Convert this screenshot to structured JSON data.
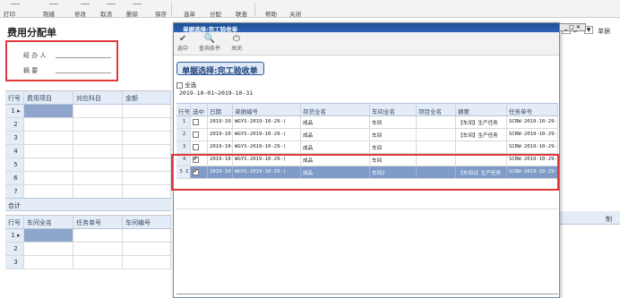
{
  "toolbar": {
    "items": [
      "打印",
      "制缝",
      "修改",
      "取消",
      "删除",
      "保存",
      "选单",
      "分配",
      "联查",
      "帮助",
      "关闭"
    ],
    "right": "单据"
  },
  "form": {
    "title": "费用分配单",
    "agent_label": "经 办 人",
    "summary_label": "摘    要"
  },
  "grid1": {
    "headers": [
      "行号",
      "费用项目",
      "对应科目",
      "金额"
    ],
    "rows": [
      "1",
      "2",
      "3",
      "4",
      "5",
      "6",
      "7"
    ],
    "total_label": "合计"
  },
  "grid2": {
    "headers": [
      "行号",
      "车间全名",
      "任务单号",
      "车间编号"
    ],
    "rows": [
      "1",
      "2",
      "3"
    ],
    "right_header": "制"
  },
  "dialog": {
    "title": "单据选择:完工验收单",
    "buttons": [
      {
        "icon": "✔",
        "label": "选中"
      },
      {
        "icon": "🔍",
        "label": "查询条件"
      },
      {
        "icon": "⏻",
        "label": "关闭"
      }
    ],
    "badge": "单据选择:完工验收单",
    "select_all": "全选",
    "date_range": "2019-10-01~2019-10-31",
    "headers": [
      "行号",
      "选中",
      "日期",
      "单据编号",
      "存货全名",
      "车间全名",
      "项目全名",
      "摘要",
      "任务单号"
    ],
    "rows": [
      {
        "no": "1",
        "checked": false,
        "date": "2019-10-",
        "code": "WGYS-2019-10-29-(",
        "item": "成品",
        "shop": "车间",
        "proj": "",
        "memo": "【车间】生产任务",
        "task": "SCRW-2019-10-29-("
      },
      {
        "no": "2",
        "checked": false,
        "date": "2019-10-",
        "code": "WGYS-2019-10-29-(",
        "item": "成品",
        "shop": "车间",
        "proj": "",
        "memo": "【车间】生产任务",
        "task": "SCRW-2019-10-29-("
      },
      {
        "no": "3",
        "checked": false,
        "date": "2019-10-",
        "code": "WGYS-2019-10-29-(",
        "item": "成品",
        "shop": "车间",
        "proj": "",
        "memo": "",
        "task": "SCRW-2019-10-29-("
      },
      {
        "no": "4",
        "checked": true,
        "date": "2019-10-",
        "code": "WGYS-2019-10-29-(",
        "item": "成品",
        "shop": "车间",
        "proj": "",
        "memo": "",
        "task": "SCRW-2019-10-29-("
      },
      {
        "no": "5",
        "checked": true,
        "date": "2019-10-",
        "code": "WGYS-2019-10-29-(",
        "item": "成品",
        "shop": "车间2",
        "proj": "",
        "memo": "【车间2】生产任务",
        "task": "SCRW-2019-10-29-("
      }
    ]
  }
}
